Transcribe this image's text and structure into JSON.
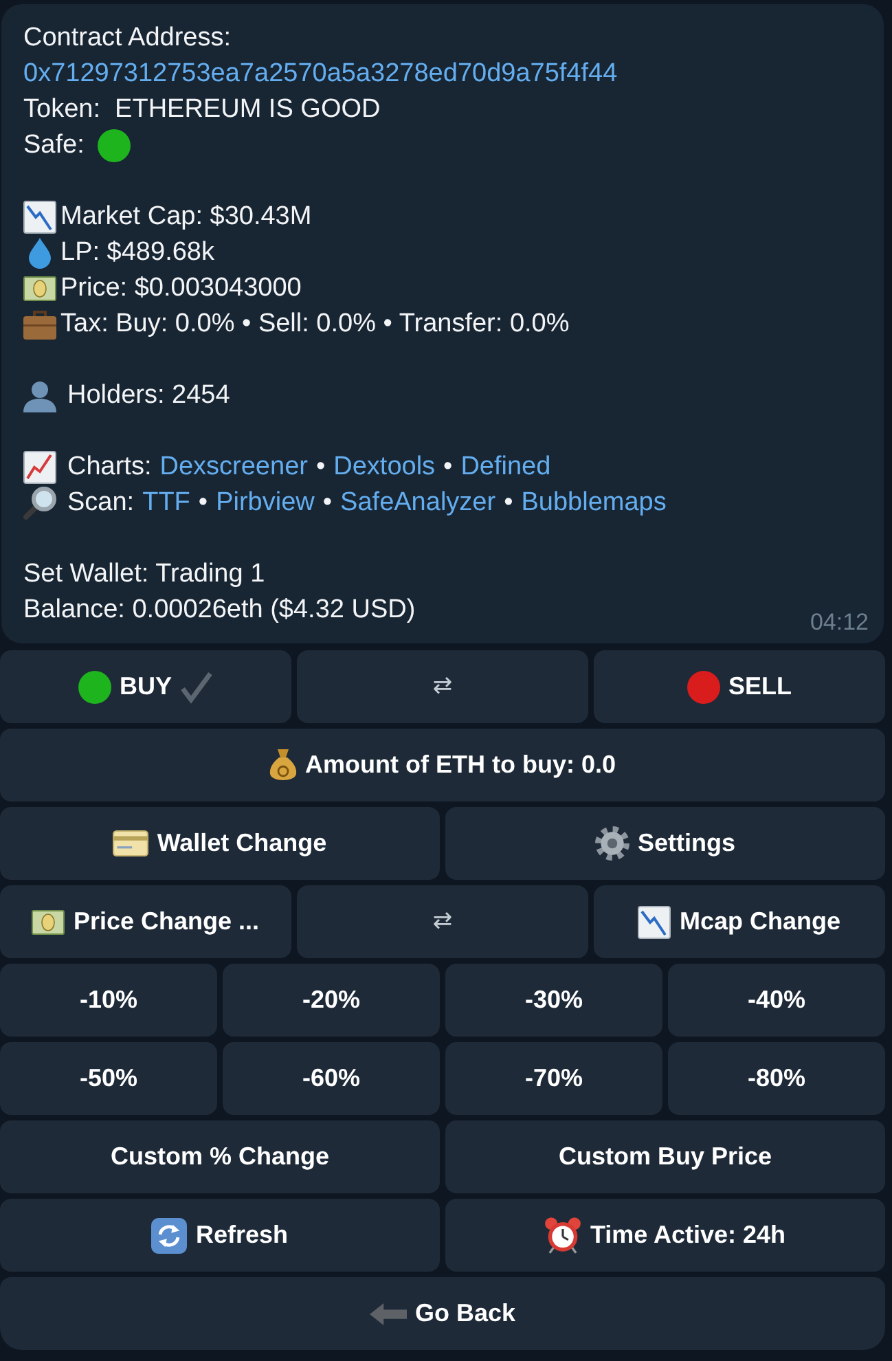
{
  "message": {
    "contract_label": "Contract Address:",
    "contract_address": "0x71297312753ea7a2570a5a3278ed70d9a75f4f44",
    "token": "Token:  ETHEREUM IS GOOD",
    "safe": {
      "label": "Safe:",
      "safe": true
    },
    "stats": [
      {
        "kind": "market_cap",
        "text": "Market Cap: $30.43M"
      },
      {
        "kind": "liquidity",
        "text": "LP: $489.68k"
      },
      {
        "kind": "price",
        "text": "Price: $0.003043000"
      },
      {
        "kind": "tax",
        "text": "Tax: Buy: 0.0% • Sell: 0.0% • Transfer: 0.0%"
      }
    ],
    "holders": "Holders: 2454",
    "link_lines": [
      {
        "kind": "charts",
        "parts": [
          {
            "kind": "label",
            "text": "Charts:"
          },
          {
            "kind": "link",
            "text": "Dexscreener"
          },
          {
            "kind": "separator",
            "text": "•"
          },
          {
            "kind": "link",
            "text": "Dextools"
          },
          {
            "kind": "separator",
            "text": "•"
          },
          {
            "kind": "link",
            "text": "Defined"
          }
        ]
      },
      {
        "kind": "scan",
        "parts": [
          {
            "kind": "label",
            "text": "Scan:"
          },
          {
            "kind": "link",
            "text": "TTF"
          },
          {
            "kind": "separator",
            "text": "•"
          },
          {
            "kind": "link",
            "text": "Pirbview"
          },
          {
            "kind": "separator",
            "text": "•"
          },
          {
            "kind": "link",
            "text": "SafeAnalyzer"
          },
          {
            "kind": "separator",
            "text": "•"
          },
          {
            "kind": "link",
            "text": "Bubblemaps"
          }
        ]
      }
    ],
    "wallet": "Set Wallet: Trading 1",
    "balance": "Balance: 0.00026eth ($4.32 USD)",
    "time": "04:12"
  },
  "keyboard": {
    "rows": [
      [
        {
          "kind": "buy",
          "label": "BUY",
          "color": "#1eb41e",
          "selected": true
        },
        {
          "kind": "swap",
          "label": "⇄"
        },
        {
          "kind": "sell",
          "label": "SELL",
          "color": "#d91c1c",
          "selected": false
        }
      ],
      [
        {
          "kind": "amount",
          "label": "Amount of ETH to buy: 0.0"
        }
      ],
      [
        {
          "kind": "wallet",
          "label": "Wallet Change"
        },
        {
          "kind": "settings",
          "label": "Settings"
        }
      ],
      [
        {
          "kind": "price",
          "label": "Price Change ..."
        },
        {
          "kind": "swap",
          "label": "⇄"
        },
        {
          "kind": "mcap",
          "label": "Mcap Change"
        }
      ],
      [
        {
          "kind": "percent",
          "label": "-10%"
        },
        {
          "kind": "percent",
          "label": "-20%"
        },
        {
          "kind": "percent",
          "label": "-30%"
        },
        {
          "kind": "percent",
          "label": "-40%"
        }
      ],
      [
        {
          "kind": "percent",
          "label": "-50%"
        },
        {
          "kind": "percent",
          "label": "-60%"
        },
        {
          "kind": "percent",
          "label": "-70%"
        },
        {
          "kind": "percent",
          "label": "-80%"
        }
      ],
      [
        {
          "kind": "custom",
          "label": "Custom % Change"
        },
        {
          "kind": "custom",
          "label": "Custom Buy Price"
        }
      ],
      [
        {
          "kind": "refresh",
          "label": "Refresh"
        },
        {
          "kind": "timer",
          "label": "Time Active: 24h"
        }
      ],
      [
        {
          "kind": "back",
          "label": "Go Back"
        }
      ]
    ]
  }
}
